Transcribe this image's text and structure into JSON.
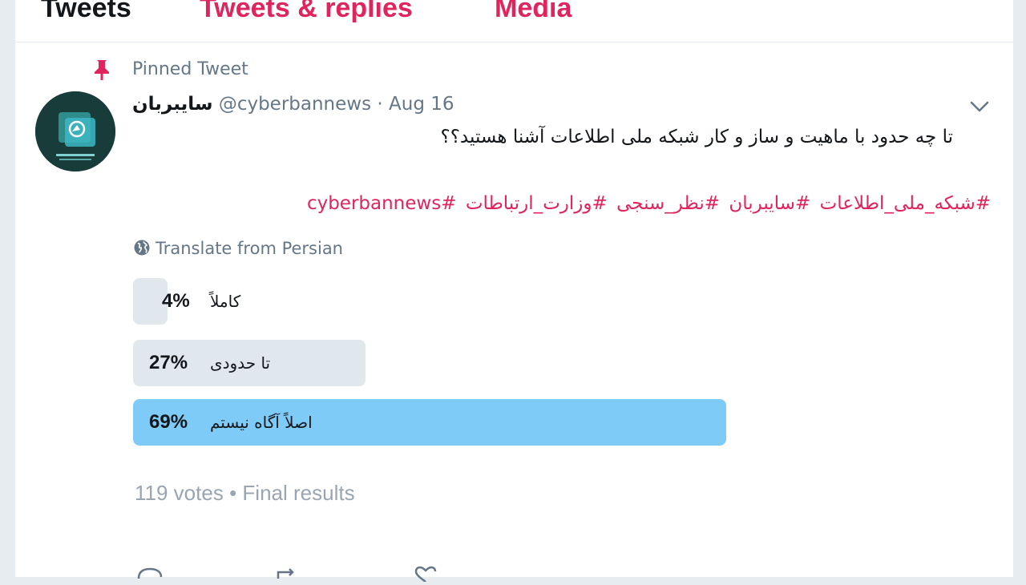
{
  "tabs": [
    {
      "label": "Tweets",
      "active": true
    },
    {
      "label": "Tweets & replies",
      "active": false
    },
    {
      "label": "Media",
      "active": false
    }
  ],
  "pinned_label": "Pinned Tweet",
  "tweet": {
    "display_name": "سایبربان",
    "handle": "@cyberbannews",
    "separator": "·",
    "date": "Aug 16",
    "text": "تا چه حدود با ماهیت و ساز و کار شبکه ملی اطلاعات آشنا هستید؟؟",
    "hashtags": [
      "#شبکه_ملی_اطلاعات",
      "#سایبربان",
      "#نظر_سنجی",
      "#وزارت_ارتباطات",
      "#cyberbannews"
    ],
    "translate_label": "Translate from Persian"
  },
  "poll": {
    "options": [
      {
        "label": "کاملاً",
        "percent_label": "4%",
        "percent": 4,
        "winner": false
      },
      {
        "label": "تا حدودی",
        "percent_label": "27%",
        "percent": 27,
        "winner": false
      },
      {
        "label": "اصلاً آگاه نیستم",
        "percent_label": "69%",
        "percent": 69,
        "winner": true
      }
    ],
    "votes_label": "119 votes",
    "bullet": "•",
    "status_label": "Final results"
  },
  "colors": {
    "accent": "#e0245e",
    "winner_bar": "#7fcbf7",
    "bar": "#e1e8ed",
    "muted_text": "#657786"
  },
  "icons": [
    "pin-icon",
    "avatar-logo",
    "chevron-down-icon",
    "globe-icon",
    "reply-icon",
    "retweet-icon",
    "like-icon"
  ]
}
